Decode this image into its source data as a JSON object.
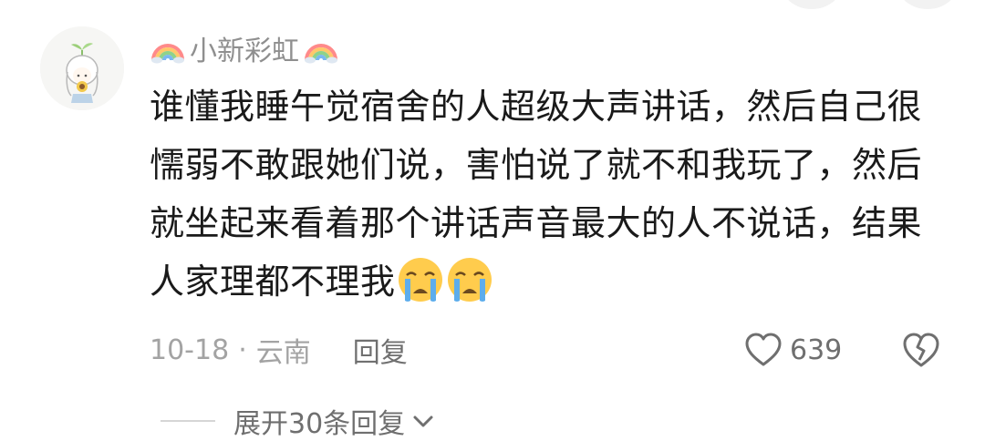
{
  "comment": {
    "username": "小新彩虹",
    "text_lines": [
      "谁懂我睡午觉宿舍的人超级大声讲话，然后自己很",
      "懦弱不敢跟她们说，害怕说了就不和我玩了，然后",
      "就坐起来看着那个讲话声音最大的人不说话，结果",
      "人家理都不理我"
    ],
    "date": "10-18",
    "separator": "·",
    "location": "云南",
    "reply_label": "回复",
    "like_count": "639",
    "expand_label": "展开30条回复"
  },
  "icons": {
    "username_prefix": "rainbow-icon",
    "username_suffix": "rainbow-icon",
    "emoji": "crying-face-emoji",
    "like": "heart-outline-icon",
    "dislike": "broken-heart-icon",
    "expand": "chevron-down-icon"
  },
  "colors": {
    "text": "#1a1a1a",
    "username": "#8f8f8f",
    "meta": "#a3a3a3",
    "secondary": "#6f6f6f"
  }
}
